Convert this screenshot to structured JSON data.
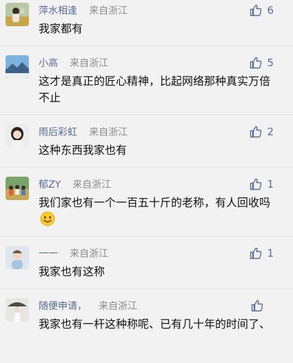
{
  "comments": [
    {
      "name": "萍水相逢",
      "from": "来自浙江",
      "likes": "6",
      "text": "我家都有",
      "avatar": "avatar-woman-field"
    },
    {
      "name": "小高",
      "from": "来自浙江",
      "likes": "5",
      "text": "这才是真正的匠心精神，比起网络那种真实万倍不止",
      "avatar": "avatar-mountain"
    },
    {
      "name": "雨后彩虹",
      "from": "来自浙江",
      "likes": "2",
      "text": "这种东西我家也有",
      "avatar": "avatar-girl"
    },
    {
      "name": "郁ZY",
      "from": "来自浙江",
      "likes": "1",
      "text": "我们家也有一个一百五十斤的老称，有人回收吗",
      "avatar": "avatar-group-photo",
      "emoji": "smile-emoji"
    },
    {
      "name": "一一",
      "from": "来自浙江",
      "likes": "1",
      "text": "我家也有这称",
      "avatar": "avatar-child"
    },
    {
      "name": "随便申请，",
      "from": "来自浙江",
      "likes": "",
      "text": "我家也有一杆这种称呢、已有几十年的时间了、",
      "avatar": "avatar-woman-umbrella"
    }
  ],
  "icons": {
    "like": "thumbs-up-icon"
  },
  "colors": {
    "name": "#576b95",
    "meta": "#8a8a8a",
    "text": "#111111",
    "background": "#f2f2f2"
  }
}
